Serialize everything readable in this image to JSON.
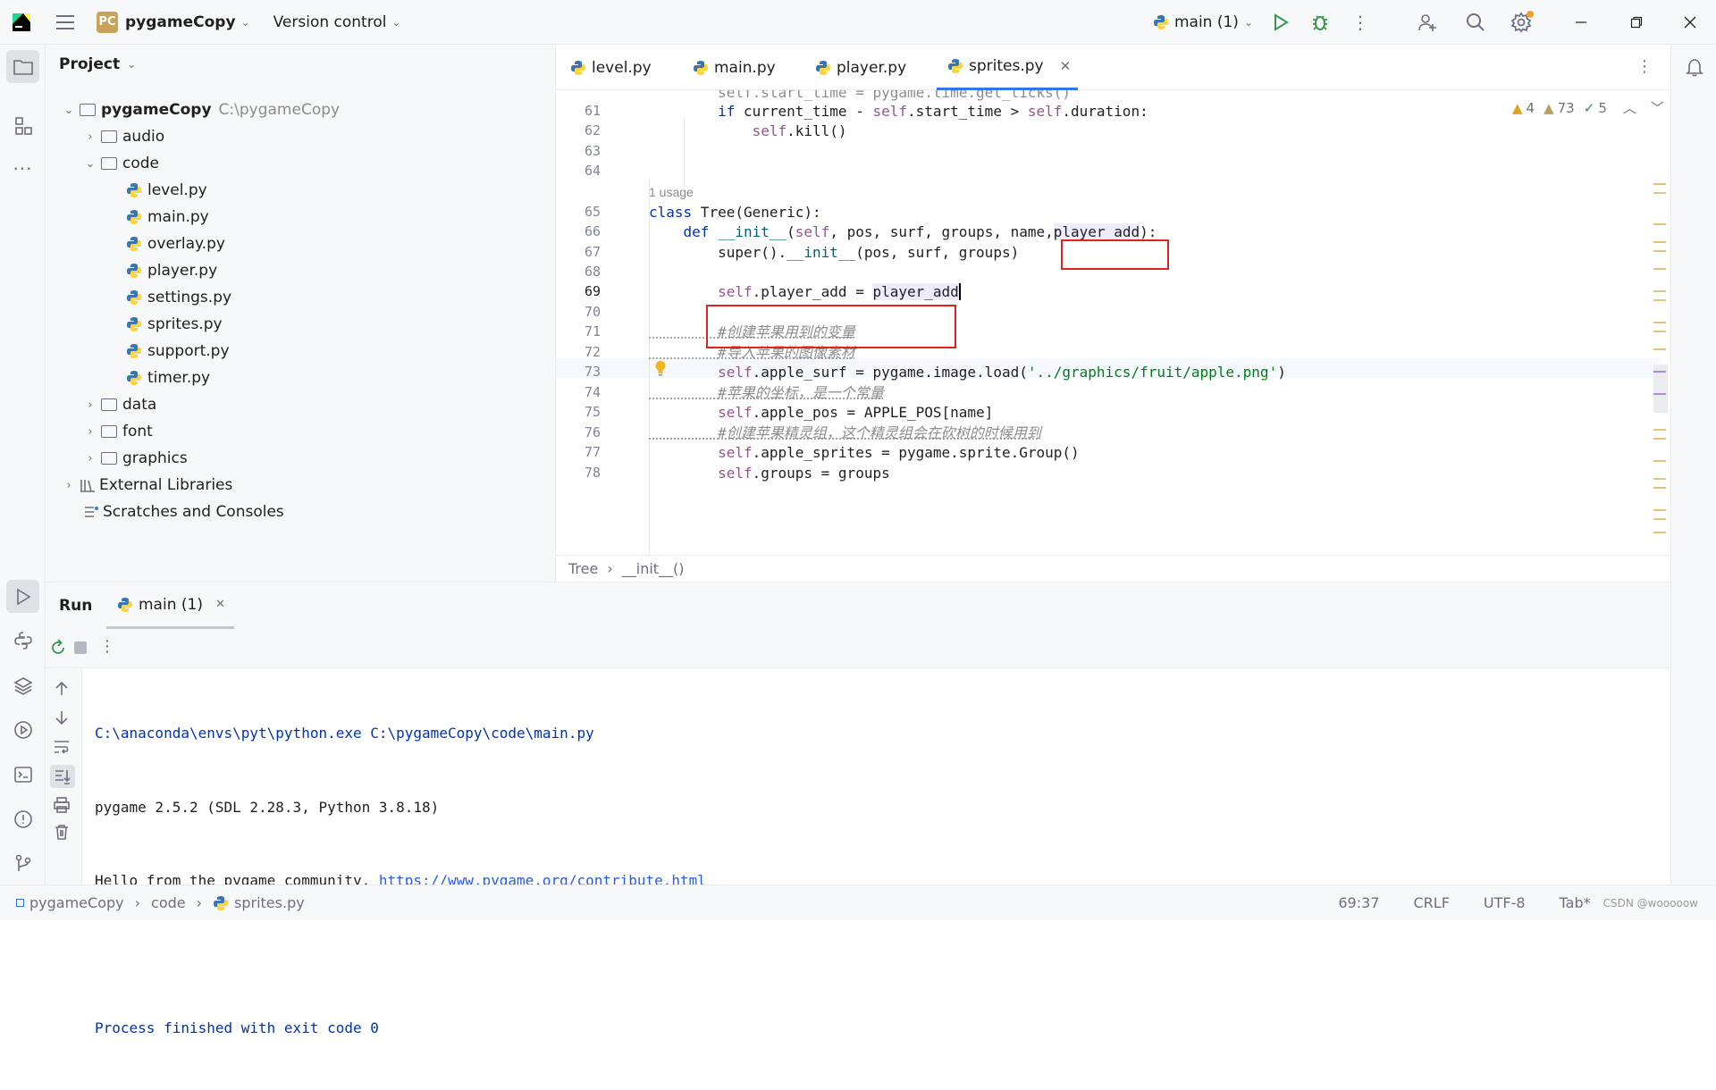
{
  "titlebar": {
    "project_badge": "PC",
    "project_name": "pygameCopy",
    "vcs": "Version control",
    "run_config": "main (1)"
  },
  "project_panel": {
    "title": "Project",
    "root": {
      "name": "pygameCopy",
      "path": "C:\\pygameCopy"
    },
    "items": [
      {
        "label": "audio",
        "type": "folder",
        "expanded": false
      },
      {
        "label": "code",
        "type": "folder",
        "expanded": true
      },
      {
        "label": "level.py",
        "type": "py"
      },
      {
        "label": "main.py",
        "type": "py"
      },
      {
        "label": "overlay.py",
        "type": "py"
      },
      {
        "label": "player.py",
        "type": "py"
      },
      {
        "label": "settings.py",
        "type": "py"
      },
      {
        "label": "sprites.py",
        "type": "py"
      },
      {
        "label": "support.py",
        "type": "py"
      },
      {
        "label": "timer.py",
        "type": "py"
      },
      {
        "label": "data",
        "type": "folder",
        "expanded": false
      },
      {
        "label": "font",
        "type": "folder",
        "expanded": false
      },
      {
        "label": "graphics",
        "type": "folder",
        "expanded": false
      },
      {
        "label": "External Libraries",
        "type": "lib"
      },
      {
        "label": "Scratches and Consoles",
        "type": "scratch"
      }
    ]
  },
  "editor": {
    "tabs": [
      {
        "label": "level.py",
        "active": false
      },
      {
        "label": "main.py",
        "active": false
      },
      {
        "label": "player.py",
        "active": false
      },
      {
        "label": "sprites.py",
        "active": true
      }
    ],
    "inspections": {
      "warn1": "4",
      "warn2": "73",
      "ok": "5"
    },
    "usage_hint": "1 usage",
    "line_numbers": [
      "61",
      "62",
      "63",
      "64",
      "65",
      "66",
      "67",
      "68",
      "69",
      "70",
      "71",
      "72",
      "73",
      "74",
      "75",
      "76",
      "77",
      "78"
    ],
    "code": {
      "l61": [
        "if",
        " current_time - ",
        "self",
        ".start_time > ",
        "self",
        ".duration:"
      ],
      "l62": [
        "self",
        ".kill()"
      ],
      "l65": [
        "class",
        " Tree(Generic):"
      ],
      "l66": [
        "def",
        " ",
        "__init__",
        "(",
        "self",
        ", pos, surf, groups, name,",
        "player_add",
        "):"
      ],
      "l67": [
        "super().",
        "__init__",
        "(pos, surf, groups)"
      ],
      "l69": [
        "self",
        ".player_add = ",
        "player_add"
      ],
      "l71": "#创建苹果用到的变量",
      "l72": "#导入苹果的图像素材",
      "l73": [
        "self",
        ".apple_surf = pygame.image.load(",
        "'../graphics/fruit/apple.png'",
        ")"
      ],
      "l74": "#苹果的坐标，是一个常量",
      "l75": [
        "self",
        ".apple_pos = APPLE_POS[name]"
      ],
      "l76": "#创建苹果精灵组，这个精灵组会在砍树的时候用到",
      "l77": [
        "self",
        ".apple_sprites = pygame.sprite.Group()"
      ],
      "l78": [
        "self",
        ".groups = groups"
      ]
    },
    "breadcrumbs": [
      "Tree",
      "__init__()"
    ]
  },
  "run_panel": {
    "title": "Run",
    "tab": "main (1)",
    "console": {
      "line1": "C:\\anaconda\\envs\\pyt\\python.exe C:\\pygameCopy\\code\\main.py",
      "line2": "pygame 2.5.2 (SDL 2.28.3, Python 3.8.18)",
      "line3_prefix": "Hello from the pygame community. ",
      "line3_link": "https://www.pygame.org/contribute.html",
      "line5": "Process finished with exit code 0"
    }
  },
  "statusbar": {
    "crumbs": [
      "pygameCopy",
      "code",
      "sprites.py"
    ],
    "position": "69:37",
    "line_sep": "CRLF",
    "encoding": "UTF-8",
    "indent": "Tab*",
    "watermark": "CSDN @wooooow"
  },
  "colors": {
    "accent": "#3574f0",
    "highlight_box": "#e0231e",
    "keyword": "#0033b3",
    "self": "#94558d",
    "string": "#067d17"
  }
}
